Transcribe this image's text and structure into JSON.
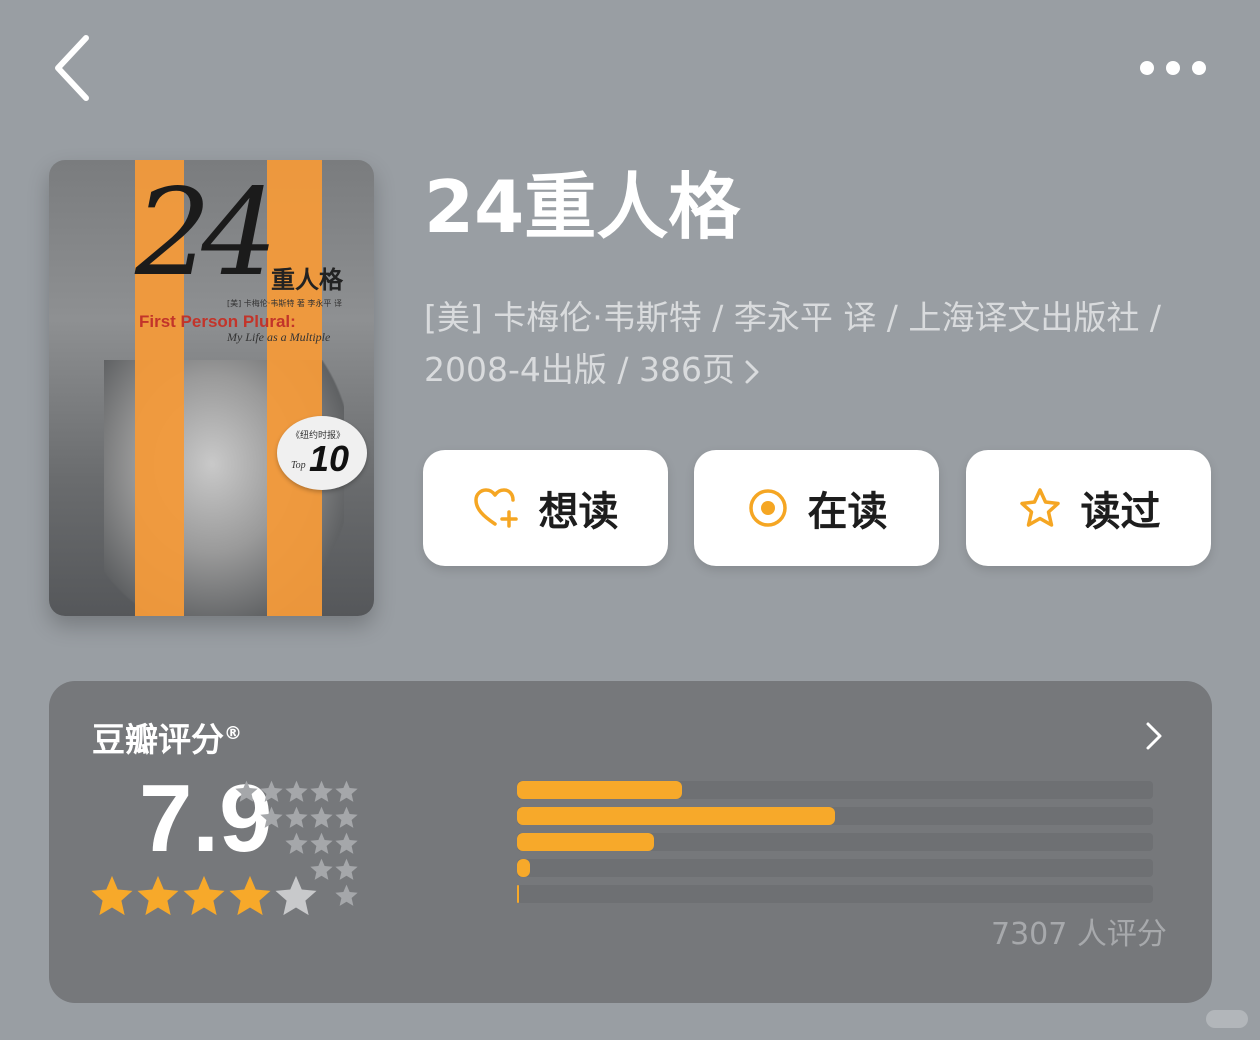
{
  "header": {
    "back_icon": "chevron-left-icon",
    "more_icon": "ellipsis-icon"
  },
  "book": {
    "title": "24重人格",
    "meta_line1": "[美] 卡梅伦·韦斯特 / 李永平 译 / 上海译文出版社 /",
    "meta_line2": "2008-4出版 / 386页"
  },
  "cover": {
    "number": "24",
    "cn_title": "重人格",
    "authors": "[美] 卡梅伦·韦斯特 著  李永平 译",
    "en_title": "First Person Plural:",
    "en_subtitle": "My Life as a Multiple",
    "badge_cn": "《纽约时报》",
    "badge_top": "Top",
    "badge_num": "10",
    "stripe_color": "#f39a3a"
  },
  "actions": [
    {
      "label": "想读",
      "icon": "heart-plus-icon"
    },
    {
      "label": "在读",
      "icon": "radio-dot-icon"
    },
    {
      "label": "读过",
      "icon": "star-outline-icon"
    }
  ],
  "rating": {
    "title": "豆瓣评分",
    "title_mark": "®",
    "score": "7.9",
    "stars_filled": 4,
    "stars_total": 5,
    "distribution": [
      {
        "stars": 5,
        "fraction": 0.26
      },
      {
        "stars": 4,
        "fraction": 0.5
      },
      {
        "stars": 3,
        "fraction": 0.215
      },
      {
        "stars": 2,
        "fraction": 0.02
      },
      {
        "stars": 1,
        "fraction": 0.003
      }
    ],
    "count_text": "7307 人评分",
    "accent_color": "#f7a92a"
  }
}
